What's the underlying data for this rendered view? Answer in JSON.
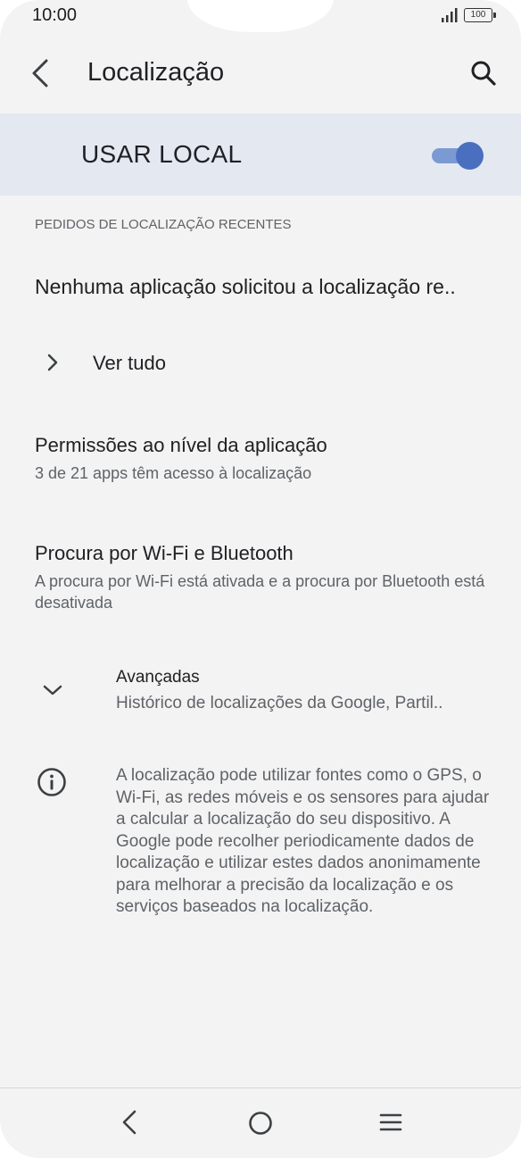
{
  "status_bar": {
    "time": "10:00",
    "battery": "100"
  },
  "app_bar": {
    "title": "Localização",
    "back_icon": "arrow-back-icon",
    "search_icon": "search-icon"
  },
  "master_switch": {
    "label": "USAR LOCAL",
    "checked": true,
    "accent_color": "#4a6fbf"
  },
  "recent_requests": {
    "header": "PEDIDOS DE LOCALIZAÇÃO RECENTES",
    "empty_text": "Nenhuma aplicação solicitou a localização re..",
    "see_all_label": "Ver tudo"
  },
  "preferences": [
    {
      "title": "Permissões ao nível da aplicação",
      "summary": "3 de 21 apps têm acesso à localização"
    },
    {
      "title": "Procura por Wi-Fi e Bluetooth",
      "summary": "A procura por Wi-Fi está ativada e a procura por Bluetooth está desativada"
    }
  ],
  "advanced": {
    "title": "Avançadas",
    "summary": "Histórico de localizações da Google, Partil.."
  },
  "footer": {
    "text": "A localização pode utilizar fontes como o GPS, o Wi-Fi, as redes móveis e os sensores para ajudar a calcular a localização do seu dispositivo. A Google pode recolher periodicamente dados de localização e utilizar estes dados anonimamente para melhorar a precisão da localização e os serviços baseados na localização."
  }
}
